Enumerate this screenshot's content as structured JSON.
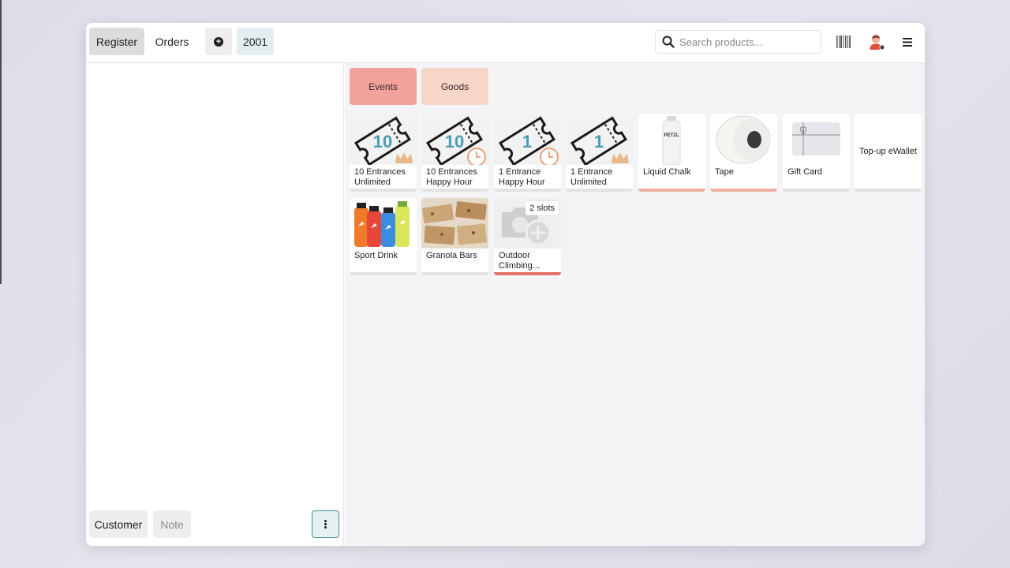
{
  "topbar": {
    "register_label": "Register",
    "orders_label": "Orders",
    "new_order_icon": "plus-circle-icon",
    "order_number": "2001",
    "search_placeholder": "Search products...",
    "barcode_icon": "barcode-icon",
    "avatar_icon": "user-avatar-icon",
    "menu_icon": "hamburger-menu-icon"
  },
  "order_panel": {
    "customer_label": "Customer",
    "note_label": "Note",
    "more_icon": "more-vertical-icon"
  },
  "categories": [
    {
      "label": "Events",
      "color": "#f3a19b"
    },
    {
      "label": "Goods",
      "color": "#f5d6c7"
    }
  ],
  "products": [
    {
      "name": "10 Entrances Unlimited",
      "badge": "10",
      "overlay": "crown"
    },
    {
      "name": "10 Entrances Happy Hour",
      "badge": "10",
      "overlay": "clock"
    },
    {
      "name": "1 Entrance Happy Hour",
      "badge": "1",
      "overlay": "clock"
    },
    {
      "name": "1 Entrance Unlimited",
      "badge": "1",
      "overlay": "crown"
    },
    {
      "name": "Liquid Chalk",
      "image_text": "PETZL"
    },
    {
      "name": "Tape"
    },
    {
      "name": "Gift Card"
    },
    {
      "name": "Top-up eWallet"
    },
    {
      "name": "Sport Drink"
    },
    {
      "name": "Granola Bars"
    },
    {
      "name": "Outdoor Climbing...",
      "slots": "2 slots"
    }
  ],
  "colors": {
    "accent_teal": "#3f8b94",
    "ticket_number": "#4a9bb5",
    "events_category": "#f3a19b",
    "goods_category": "#f5d6c7"
  }
}
